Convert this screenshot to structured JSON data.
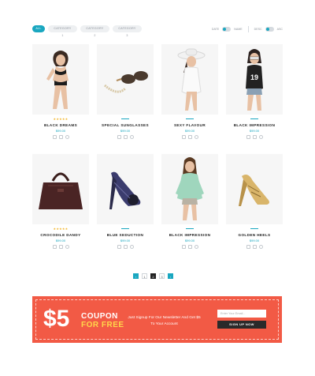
{
  "filters": {
    "tabs": [
      {
        "label": "ALL"
      },
      {
        "label": "CATEGORY 1"
      },
      {
        "label": "CATEGORY 2"
      },
      {
        "label": "CATEGORY 3"
      }
    ]
  },
  "sort": {
    "first_label": "DATE",
    "second_label": "NAME",
    "third_label": "DESC",
    "fourth_label": "ASC"
  },
  "products": [
    {
      "name": "BLACK DREAMS",
      "price": "$99.00",
      "stars": "★★★★★",
      "icon": "lingerie-model"
    },
    {
      "name": "SPECIAL SUNGLASSES",
      "price": "$99.00",
      "stars": "",
      "icon": "sunglasses"
    },
    {
      "name": "SEXY FLAVOUR",
      "price": "$99.00",
      "stars": "",
      "icon": "hat-model"
    },
    {
      "name": "BLACK IMPRESSION",
      "price": "$99.00",
      "stars": "",
      "icon": "jersey-model"
    },
    {
      "name": "CROCODILE DANDY",
      "price": "$99.00",
      "stars": "★★★★★",
      "icon": "handbag"
    },
    {
      "name": "BLUE SEDUCTION",
      "price": "$99.00",
      "stars": "",
      "icon": "high-heel-shoe"
    },
    {
      "name": "BLACK IMPRESSION",
      "price": "$99.00",
      "stars": "",
      "icon": "green-blouse-model"
    },
    {
      "name": "GOLDEN HEELS",
      "price": "$99.00",
      "stars": "",
      "icon": "gold-sandal"
    }
  ],
  "pagination": {
    "prev": "‹",
    "pages": [
      "1",
      "2",
      "3"
    ],
    "current": "2",
    "next": "›"
  },
  "coupon": {
    "amount": "$5",
    "line1": "COUPON",
    "line2": "FOR FREE",
    "text": "Just Signup For Our Newsletter And Get $5 To Your Account",
    "input_placeholder": "Enter Your Email...",
    "button_label": "SIGN UP NOW",
    "colors": {
      "background": "#f25a45",
      "accent": "#ffd64a"
    }
  },
  "accent_color": "#1aa7c0"
}
